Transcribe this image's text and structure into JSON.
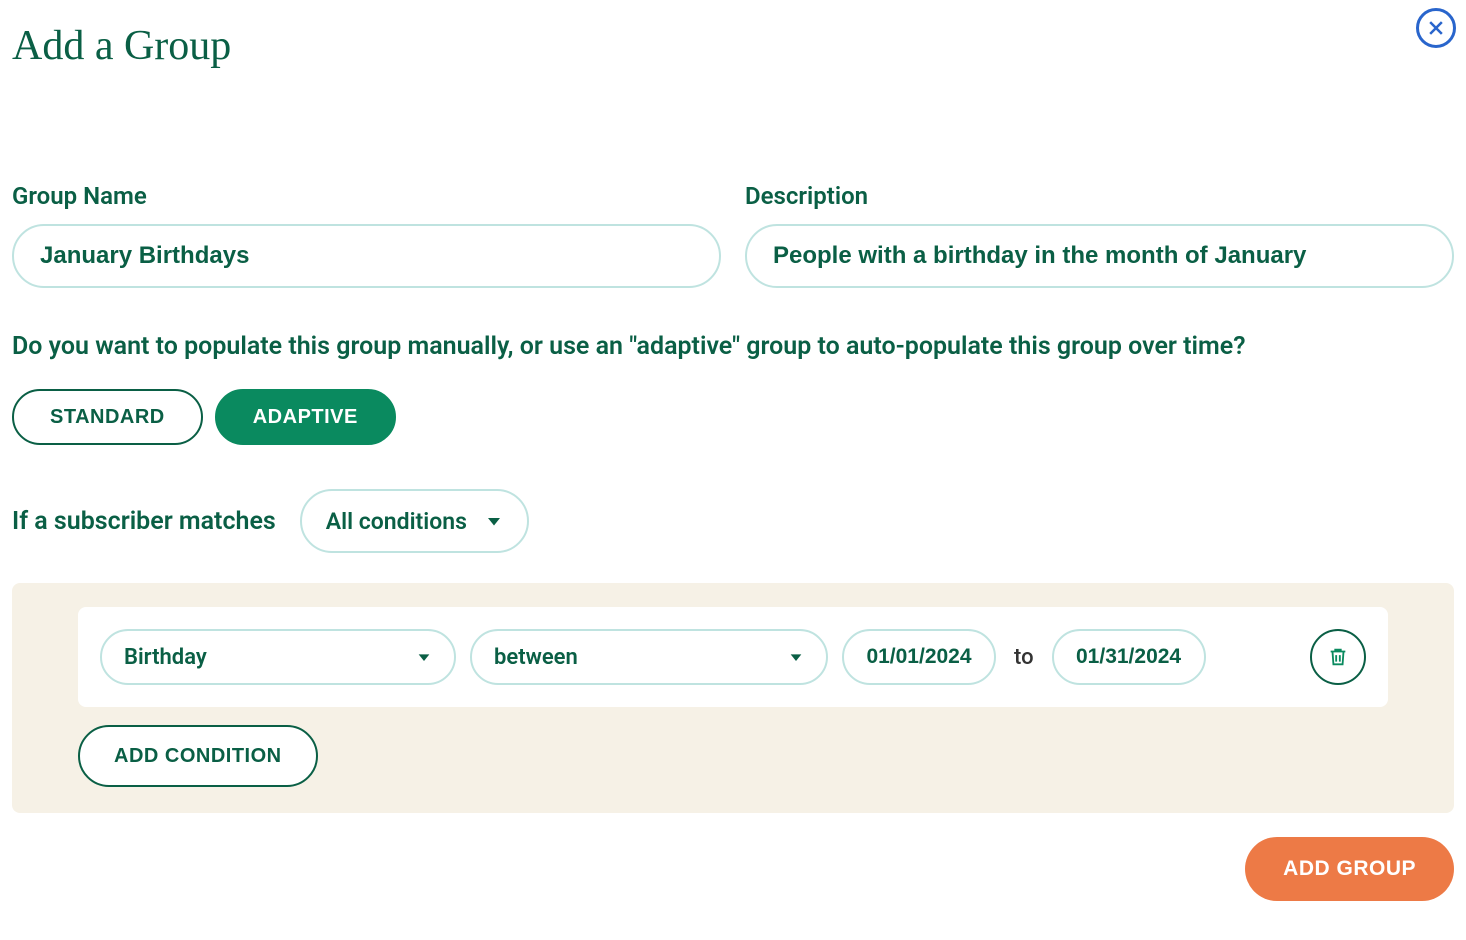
{
  "title": "Add a Group",
  "labels": {
    "group_name": "Group Name",
    "description": "Description",
    "prompt": "Do you want to populate this group manually, or use an \"adaptive\" group to auto-populate this group over time?",
    "standard": "STANDARD",
    "adaptive": "ADAPTIVE",
    "match_prefix": "If a subscriber matches",
    "to": "to",
    "add_condition": "ADD CONDITION",
    "submit": "ADD GROUP"
  },
  "values": {
    "group_name": "January Birthdays",
    "description": "People with a birthday in the month of January",
    "match_mode": "All conditions"
  },
  "condition": {
    "field": "Birthday",
    "operator": "between",
    "date_from": "01/01/2024",
    "date_to": "01/31/2024"
  }
}
